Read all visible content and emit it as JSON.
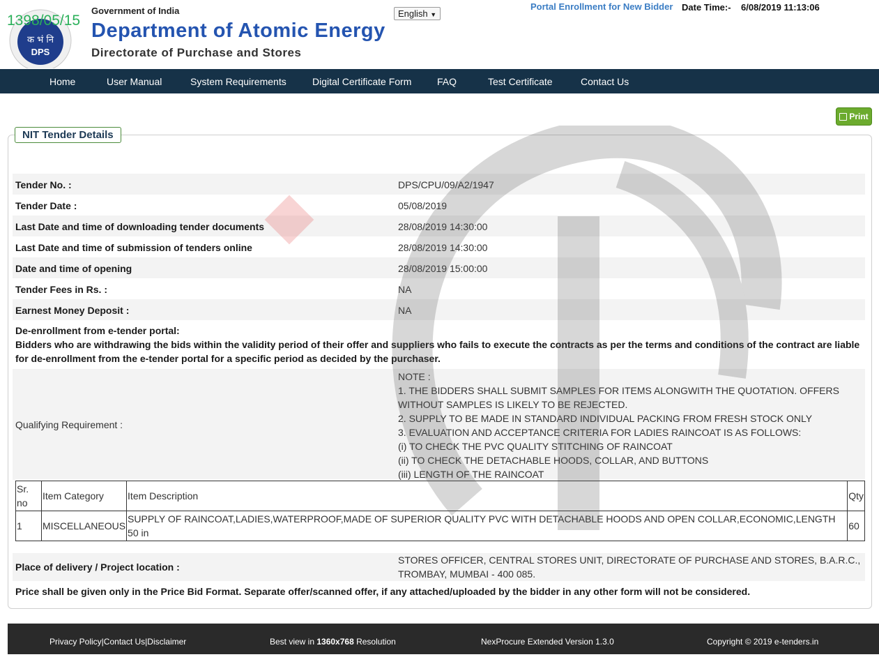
{
  "header": {
    "logo_date": "1398/05/15",
    "gov_label": "Government of India",
    "dept_label": "Department of Atomic Energy",
    "dir_label": "Directorate of Purchase and Stores",
    "logo_text": "DPS",
    "logo_hindi": "क भं नि",
    "language": "English",
    "enroll_link": "Portal Enrollment for New Bidder",
    "datetime_label": "Date Time:-",
    "datetime_value": "6/08/2019 11:13:06"
  },
  "nav": {
    "items": [
      "Home",
      "User Manual",
      "System Requirements",
      "Digital Certificate Form",
      "FAQ",
      "Test Certificate",
      "Contact Us"
    ]
  },
  "print_label": "Print",
  "panel": {
    "legend": "NIT Tender Details",
    "fields": [
      {
        "label": "Tender No. :",
        "value": "DPS/CPU/09/A2/1947"
      },
      {
        "label": "Tender Date :",
        "value": "05/08/2019"
      },
      {
        "label": "Last Date and time of downloading tender documents",
        "value": "28/08/2019 14:30:00"
      },
      {
        "label": "Last Date and time of submission of tenders online",
        "value": "28/08/2019 14:30:00"
      },
      {
        "label": "Date and time of opening",
        "value": "28/08/2019 15:00:00"
      },
      {
        "label": "Tender Fees in Rs. :",
        "value": "NA"
      },
      {
        "label": "Earnest Money Deposit :",
        "value": "NA"
      }
    ],
    "deenroll_title": "De-enrollment from e-tender portal:",
    "deenroll_text": "Bidders who are withdrawing the bids within the validity period of their offer and suppliers who fails to execute the contracts as per the terms and conditions of the contract are liable for de-enrollment from the e-tender portal for a specific period as decided by the purchaser.",
    "qualifying_label": "Qualifying Requirement :",
    "qualifying_lines": [
      "NOTE :",
      "1. THE BIDDERS SHALL SUBMIT SAMPLES FOR ITEMS ALONGWITH THE QUOTATION. OFFERS",
      "WITHOUT SAMPLES IS LIKELY TO BE REJECTED.",
      "2. SUPPLY TO BE MADE IN STANDARD INDIVIDUAL PACKING FROM FRESH STOCK ONLY",
      "3. EVALUATION AND ACCEPTANCE CRITERIA FOR LADIES RAINCOAT IS AS FOLLOWS:",
      "(i) TO CHECK THE PVC QUALITY STITCHING OF RAINCOAT",
      "(ii) TO CHECK THE DETACHABLE HOODS, COLLAR, AND BUTTONS",
      "(iii) LENGTH OF THE RAINCOAT"
    ],
    "item_table": {
      "headers": [
        "Sr. no",
        "Item Category",
        "Item Description",
        "Qty"
      ],
      "rows": [
        [
          "1",
          "MISCELLANEOUS",
          "SUPPLY OF RAINCOAT,LADIES,WATERPROOF,MADE OF SUPERIOR QUALITY PVC WITH DETACHABLE HOODS AND OPEN COLLAR,ECONOMIC,LENGTH 50 in",
          "60"
        ]
      ]
    },
    "delivery_label": "Place of delivery / Project location :",
    "delivery_value": "STORES OFFICER, CENTRAL STORES UNIT, DIRECTORATE OF PURCHASE AND STORES, B.A.R.C., TROMBAY, MUMBAI - 400 085.",
    "price_note": "Price shall be given only in the Price Bid Format. Separate offer/scanned offer, if any attached/uploaded by the bidder in any other form will not be considered."
  },
  "footer": {
    "privacy": "Privacy Policy|Contact Us|Disclaimer",
    "best_prefix": "Best view in ",
    "best_res": "1360x768",
    "best_suffix": " Resolution",
    "version": "NexProcure Extended Version 1.3.0",
    "copyright": "Copyright © 2019 e-tenders.in"
  },
  "colors": {
    "nav_bg": "#163248",
    "dept_blue": "#2454b0",
    "print_green": "#6cab2e",
    "footer_bg": "#2a2a2a",
    "row_shade": "#f3f3f3"
  }
}
